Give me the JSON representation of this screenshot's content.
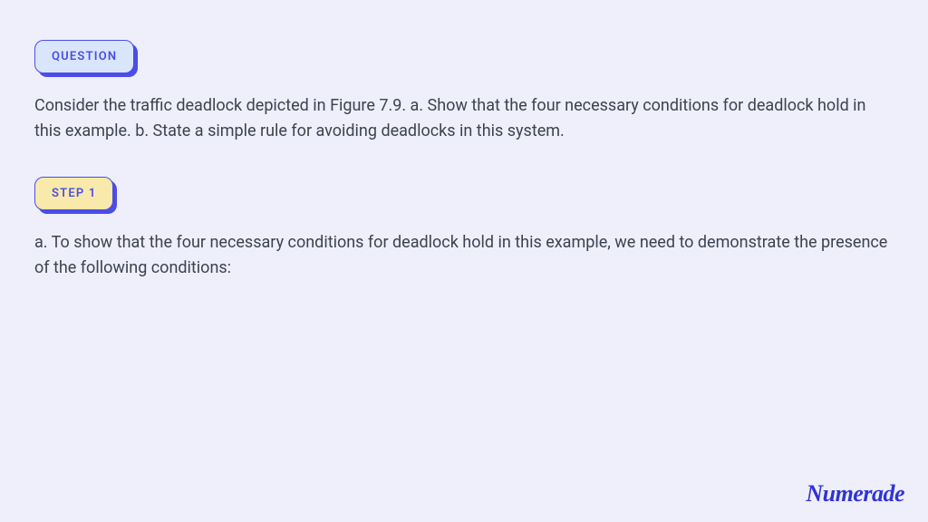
{
  "question": {
    "badge_label": "QUESTION",
    "text": "Consider the traffic deadlock depicted in Figure 7.9. a. Show that the four necessary conditions for deadlock hold in this example. b. State a simple rule for avoiding deadlocks in this system."
  },
  "step": {
    "badge_label": "STEP 1",
    "text": "a. To show that the four necessary conditions for deadlock hold in this example, we need to demonstrate the presence of the following conditions:"
  },
  "brand": "Numerade"
}
